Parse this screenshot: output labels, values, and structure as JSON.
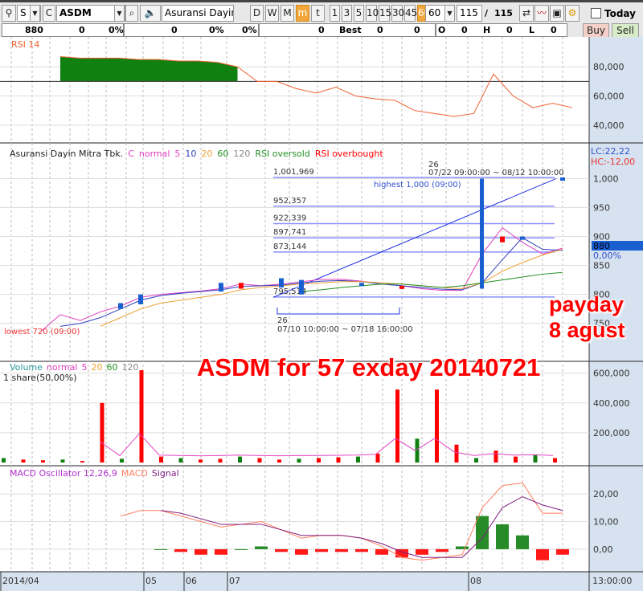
{
  "toolbar": {
    "type": "S",
    "c": "C",
    "symbol": "ASDM",
    "name": "Asuransi Dayin I",
    "periods": [
      "D",
      "W",
      "M",
      "m",
      "t"
    ],
    "minutes": [
      "1",
      "3",
      "5",
      "10",
      "15",
      "30",
      "45",
      "60"
    ],
    "interval": "60",
    "count": "115",
    "total": "115",
    "slash": "/",
    "today": "Today"
  },
  "info": {
    "price": "880",
    "chg": "0",
    "pct": "0%",
    "v2": "0",
    "p2": "0%",
    "p3": "0%",
    "v3": "0",
    "best": "Best",
    "b1": "0",
    "b2": "0",
    "o": "O",
    "ov": "0",
    "h": "H",
    "hv": "0",
    "l": "L",
    "lv": "0",
    "buy": "Buy",
    "sell": "Sell"
  },
  "colors": {
    "up": "#ff0000",
    "down": "#1a5fd0",
    "panel": "#d6e2ef",
    "ma5": "#e040c0",
    "ma10": "#3040c0",
    "ma20": "#f0a030",
    "ma60": "#209020",
    "ma120": "#888888",
    "rsi": "#f06030",
    "fill": "#108010"
  },
  "chart_data": [
    {
      "type": "area",
      "title": "RSI 14",
      "yticks": [
        "80,000",
        "60,000",
        "40,000"
      ],
      "yvals": [
        80,
        60,
        40
      ],
      "ylim": [
        30,
        95
      ],
      "threshold": 70,
      "values": [
        87,
        86,
        86,
        86,
        85,
        85,
        84,
        84,
        83,
        80,
        70,
        70,
        65,
        62,
        66,
        60,
        58,
        57,
        50,
        48,
        46,
        48,
        75,
        60,
        52,
        55,
        52
      ]
    },
    {
      "type": "line",
      "legend": {
        "name": "Asuransi Dayin Mitra Tbk.",
        "c": "C",
        "normal": "normal",
        "ma": [
          "5",
          "10",
          "20",
          "60",
          "120"
        ],
        "oversold": "RSI oversold",
        "overbought": "RSI overbought"
      },
      "yticks": [
        "1,000",
        "950",
        "900",
        "850",
        "800",
        "750"
      ],
      "yvals": [
        1000,
        950,
        900,
        850,
        800,
        750
      ],
      "ylim": [
        690,
        1045
      ],
      "series": [
        {
          "name": "5",
          "values": [
            735,
            765,
            755,
            770,
            780,
            795,
            800,
            803,
            806,
            810,
            818,
            815,
            818,
            822,
            826,
            826,
            823,
            818,
            815,
            810,
            807,
            807,
            870,
            915,
            890,
            870,
            880
          ]
        },
        {
          "name": "10",
          "values": [
            null,
            745,
            750,
            760,
            775,
            790,
            798,
            802,
            805,
            808,
            814,
            815,
            816,
            820,
            823,
            824,
            822,
            818,
            815,
            812,
            809,
            808,
            820,
            860,
            898,
            878,
            876
          ]
        },
        {
          "name": "20",
          "values": [
            null,
            null,
            null,
            745,
            760,
            775,
            785,
            790,
            795,
            800,
            808,
            812,
            815,
            818,
            820,
            822,
            822,
            820,
            818,
            815,
            812,
            810,
            820,
            840,
            855,
            868,
            878
          ]
        },
        {
          "name": "60",
          "values": [
            null,
            null,
            null,
            null,
            null,
            null,
            null,
            null,
            null,
            null,
            null,
            null,
            null,
            805,
            808,
            812,
            815,
            818,
            818,
            815,
            812,
            815,
            820,
            825,
            830,
            835,
            838
          ]
        }
      ],
      "candles": [
        [
          4,
          775,
          785
        ],
        [
          5,
          783,
          800
        ],
        [
          9,
          805,
          820
        ],
        [
          10,
          820,
          810
        ],
        [
          12,
          812,
          828
        ],
        [
          13,
          800,
          825
        ],
        [
          16,
          815,
          820
        ],
        [
          18,
          815,
          812
        ],
        [
          22,
          810,
          1000
        ],
        [
          23,
          900,
          890
        ],
        [
          24,
          895,
          900
        ],
        [
          26,
          1000,
          1002
        ]
      ],
      "fib": [
        {
          "v": 1001.969,
          "t": "1,001,969"
        },
        {
          "v": 952.357,
          "t": "952,357"
        },
        {
          "v": 922.339,
          "t": "922,339"
        },
        {
          "v": 897.741,
          "t": "897,741"
        },
        {
          "v": 873.144,
          "t": "873,144"
        },
        {
          "v": 795.514,
          "t": "795,514"
        }
      ],
      "labels": {
        "highest": "highest 1,000 (09:00)",
        "lowest": "lowest 720 (09:00)",
        "n1": "26",
        "r1": "07/22 09:00:00 ~ 08/12 10:00:00",
        "n2": "26",
        "r2": "07/10 10:00:00 ~ 07/18 16:00:00",
        "lc": "LC:22,22",
        "hc": "HC:-12,00",
        "last": "880",
        "lastpct": "0,00%"
      }
    },
    {
      "type": "bar",
      "legend": {
        "name": "Volume",
        "normal": "normal",
        "ma": [
          "5",
          "20",
          "60",
          "120"
        ],
        "unit": "1 share(50,00%)"
      },
      "yticks": [
        "600,000",
        "400,000",
        "200,000"
      ],
      "yvals": [
        600000,
        400000,
        200000
      ],
      "ylim": [
        0,
        620000
      ],
      "values": [
        30000,
        20000,
        15000,
        20000,
        10000,
        400000,
        25000,
        620000,
        40000,
        30000,
        20000,
        25000,
        40000,
        30000,
        20000,
        25000,
        30000,
        35000,
        40000,
        60000,
        490000,
        160000,
        490000,
        120000,
        30000,
        80000,
        40000,
        50000,
        30000
      ]
    },
    {
      "type": "bar",
      "legend": {
        "name": "MACD Oscillator 12,26,9",
        "macd": "MACD",
        "signal": "Signal"
      },
      "yticks": [
        "20,00",
        "10,00",
        "0,00"
      ],
      "yvals": [
        20,
        10,
        0
      ],
      "ylim": [
        -7,
        27
      ],
      "macd": [
        12,
        14,
        14,
        12,
        10,
        8,
        9,
        10,
        7,
        4,
        5,
        5,
        4,
        1,
        -3,
        -4,
        -3,
        -2,
        15,
        23,
        24,
        13,
        13
      ],
      "signal": [
        null,
        null,
        14,
        13,
        11,
        9,
        9,
        9,
        7,
        5,
        5,
        5,
        4,
        2,
        -1,
        -3,
        -3,
        -3,
        4,
        15,
        19,
        16,
        14
      ],
      "hist": [
        null,
        null,
        0,
        -1,
        -2,
        -2,
        0,
        1,
        -1,
        -2,
        -1,
        -1,
        -1,
        -2,
        -3,
        -2,
        -1,
        1,
        12,
        9,
        5,
        -4,
        -2
      ]
    },
    {
      "type": "axis",
      "ticks": [
        "2014/04",
        "05",
        "06",
        "07",
        "08"
      ],
      "time": "13:00:00"
    }
  ],
  "annotations": {
    "main": "ASDM for 57 exday 20140721",
    "pay1": "payday",
    "pay2": "8 agust"
  }
}
